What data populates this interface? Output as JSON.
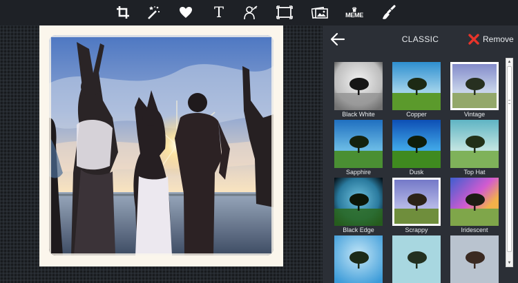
{
  "toolbar": {
    "tools": [
      {
        "id": "crop",
        "icon": "crop-icon"
      },
      {
        "id": "enhance",
        "icon": "magic-wand-icon"
      },
      {
        "id": "stickers",
        "icon": "heart-icon"
      },
      {
        "id": "text",
        "icon": "text-icon",
        "glyph": "T"
      },
      {
        "id": "effects",
        "icon": "silhouette-brush-icon"
      },
      {
        "id": "frames",
        "icon": "frame-icon"
      },
      {
        "id": "overlays",
        "icon": "images-icon"
      },
      {
        "id": "meme",
        "icon": "meme-icon",
        "label": "MEME",
        "crown": "♛"
      },
      {
        "id": "draw",
        "icon": "brush-icon"
      }
    ]
  },
  "panel": {
    "title": "CLASSIC",
    "remove_label": "Remove",
    "colors": {
      "remove_x": "#e8342a",
      "panel_bg": "#2b2f36"
    }
  },
  "filters": [
    {
      "name": "Black White",
      "selected": false
    },
    {
      "name": "Copper",
      "selected": false
    },
    {
      "name": "Vintage",
      "selected": true
    },
    {
      "name": "Sapphire",
      "selected": false
    },
    {
      "name": "Dusk",
      "selected": false
    },
    {
      "name": "Top Hat",
      "selected": false
    },
    {
      "name": "Black Edge",
      "selected": false
    },
    {
      "name": "Scrappy",
      "selected": true
    },
    {
      "name": "Iridescent",
      "selected": false
    },
    {
      "name": "",
      "selected": false
    },
    {
      "name": "",
      "selected": false
    },
    {
      "name": "",
      "selected": false
    }
  ]
}
